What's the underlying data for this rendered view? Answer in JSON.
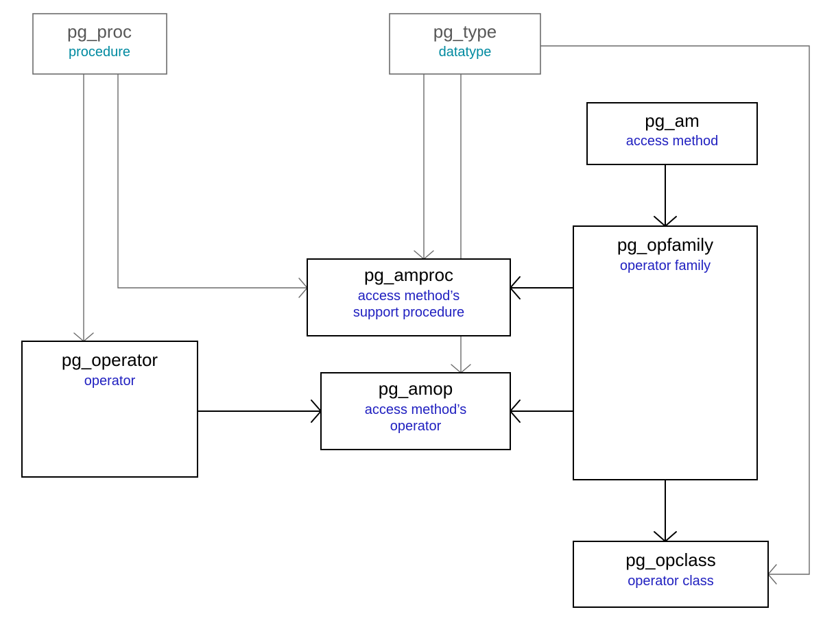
{
  "nodes": {
    "pg_proc": {
      "title": "pg_proc",
      "sub": "procedure"
    },
    "pg_type": {
      "title": "pg_type",
      "sub": "datatype"
    },
    "pg_am": {
      "title": "pg_am",
      "sub": "access method"
    },
    "pg_operator": {
      "title": "pg_operator",
      "sub": "operator"
    },
    "pg_amproc": {
      "title": "pg_amproc",
      "sub1": "access method’s",
      "sub2": "support procedure"
    },
    "pg_amop": {
      "title": "pg_amop",
      "sub1": "access method’s",
      "sub2": "operator"
    },
    "pg_opfamily": {
      "title": "pg_opfamily",
      "sub": "operator family"
    },
    "pg_opclass": {
      "title": "pg_opclass",
      "sub": "operator class"
    }
  },
  "edges": [
    {
      "from": "pg_proc",
      "to": "pg_operator",
      "style": "light"
    },
    {
      "from": "pg_proc",
      "to": "pg_amproc",
      "style": "light"
    },
    {
      "from": "pg_type",
      "to": "pg_amproc",
      "style": "light"
    },
    {
      "from": "pg_type",
      "to": "pg_amop",
      "style": "light"
    },
    {
      "from": "pg_type",
      "to": "pg_opclass",
      "style": "light"
    },
    {
      "from": "pg_am",
      "to": "pg_opfamily",
      "style": "heavy"
    },
    {
      "from": "pg_operator",
      "to": "pg_amop",
      "style": "heavy"
    },
    {
      "from": "pg_opfamily",
      "to": "pg_amproc",
      "style": "heavy"
    },
    {
      "from": "pg_opfamily",
      "to": "pg_amop",
      "style": "heavy"
    },
    {
      "from": "pg_opfamily",
      "to": "pg_opclass",
      "style": "heavy"
    }
  ]
}
